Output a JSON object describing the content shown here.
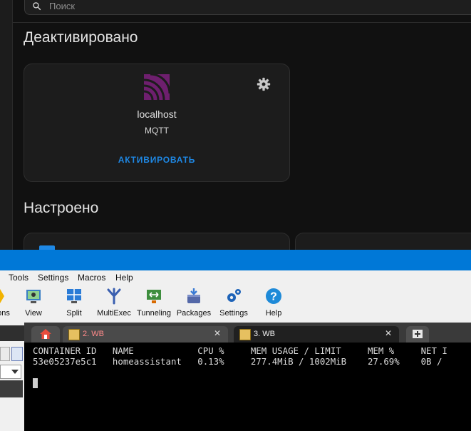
{
  "ha": {
    "search_placeholder": "Поиск",
    "section_deactivated": "Деактивировано",
    "section_configured": "Настроено",
    "card": {
      "title": "localhost",
      "subtitle": "MQTT",
      "action": "АКТИВИРОВАТЬ",
      "logo_color": "#6e1f6e",
      "accent": "#1e88e5"
    },
    "icons": {
      "search": "search-icon",
      "gear": "gear-icon",
      "logo": "mqtt-logo-icon"
    }
  },
  "moba": {
    "menu": [
      "Tools",
      "Settings",
      "Macros",
      "Help"
    ],
    "toolbar": [
      {
        "label": "ons",
        "icon": "sessions-icon"
      },
      {
        "label": "View",
        "icon": "view-icon"
      },
      {
        "label": "Split",
        "icon": "split-icon"
      },
      {
        "label": "MultiExec",
        "icon": "multiexec-icon"
      },
      {
        "label": "Tunneling",
        "icon": "tunneling-icon"
      },
      {
        "label": "Packages",
        "icon": "packages-icon"
      },
      {
        "label": "Settings",
        "icon": "settings-icon"
      },
      {
        "label": "Help",
        "icon": "help-icon"
      }
    ],
    "tabs": [
      {
        "label": "2. WB",
        "color": "#ff8a8a",
        "active": false
      },
      {
        "label": "3. WB",
        "color": "#f2f2f2",
        "active": true
      }
    ],
    "terminal": {
      "header": "CONTAINER ID   NAME            CPU %     MEM USAGE / LIMIT     MEM %     NET I",
      "row": "53e05237e5c1   homeassistant   0.13%     277.4MiB / 1002MiB    27.69%    0B /"
    },
    "colors": {
      "titlebar": "#0078d7",
      "terminal_bg": "#000000"
    }
  }
}
